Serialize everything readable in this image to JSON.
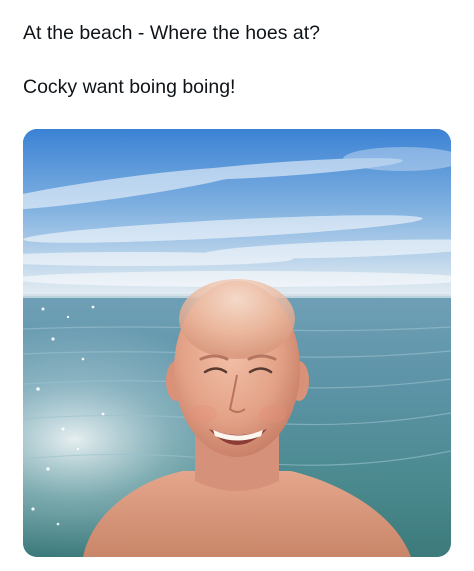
{
  "post": {
    "lines": [
      "At the beach - Where the hoes at?",
      "Cocky want boing boing!"
    ]
  },
  "media": {
    "type": "photo",
    "colors": {
      "sky_top": "#3f86d6",
      "sky_horizon": "#e4ecf3",
      "sea_far": "#6c9db3",
      "sea_near": "#3e7f88",
      "skin": "#e9a98f",
      "skin_shadow": "#c97c64"
    }
  }
}
